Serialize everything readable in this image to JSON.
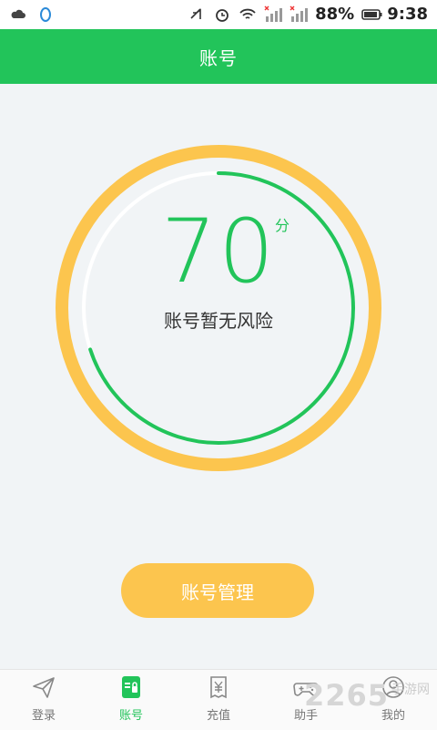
{
  "status_bar": {
    "battery": "88%",
    "time": "9:38"
  },
  "header": {
    "title": "账号"
  },
  "score_card": {
    "score": "70",
    "unit": "分",
    "status": "账号暂无风险",
    "score_fraction": 0.7,
    "colors": {
      "green": "#22c45a",
      "orange": "#fcc54e",
      "track": "#ffffff"
    }
  },
  "actions": {
    "manage_label": "账号管理"
  },
  "tabbar": {
    "items": [
      {
        "label": "登录",
        "icon": "paper-plane-icon",
        "active": false
      },
      {
        "label": "账号",
        "icon": "account-card-icon",
        "active": true
      },
      {
        "label": "充值",
        "icon": "yen-receipt-icon",
        "active": false
      },
      {
        "label": "助手",
        "icon": "gamepad-icon",
        "active": false
      },
      {
        "label": "我的",
        "icon": "user-icon",
        "active": false
      }
    ]
  },
  "watermark": {
    "big": "2265",
    "small": "手游网"
  }
}
